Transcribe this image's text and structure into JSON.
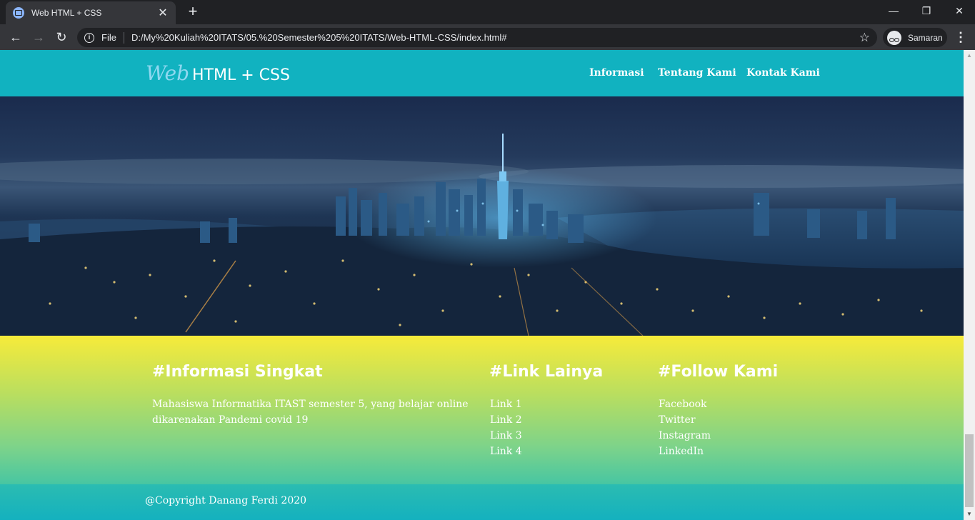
{
  "browser": {
    "tab_title": "Web HTML + CSS",
    "scheme_label": "File",
    "url": "D:/My%20Kuliah%20ITATS/05.%20Semester%205%20ITATS/Web-HTML-CSS/index.html#",
    "profile_label": "Samaran"
  },
  "site": {
    "logo_italic": "Web",
    "logo_rest": "HTML + CSS",
    "nav": [
      "Informasi",
      "Tentang Kami",
      "Kontak Kami"
    ]
  },
  "info": {
    "title": "#Informasi Singkat",
    "text_lines": [
      "Mahasiswa Informatika ITAST semester 5, yang belajar online",
      "dikarenakan Pandemi covid 19"
    ]
  },
  "links": {
    "title": "#Link Lainya",
    "items": [
      "Link 1",
      "Link 2",
      "Link 3",
      "Link 4"
    ]
  },
  "follow": {
    "title": "#Follow Kami",
    "items": [
      "Facebook",
      "Twitter",
      "Instagram",
      "LinkedIn"
    ]
  },
  "footer": {
    "copyright": "@Copyright Danang Ferdi 2020"
  }
}
